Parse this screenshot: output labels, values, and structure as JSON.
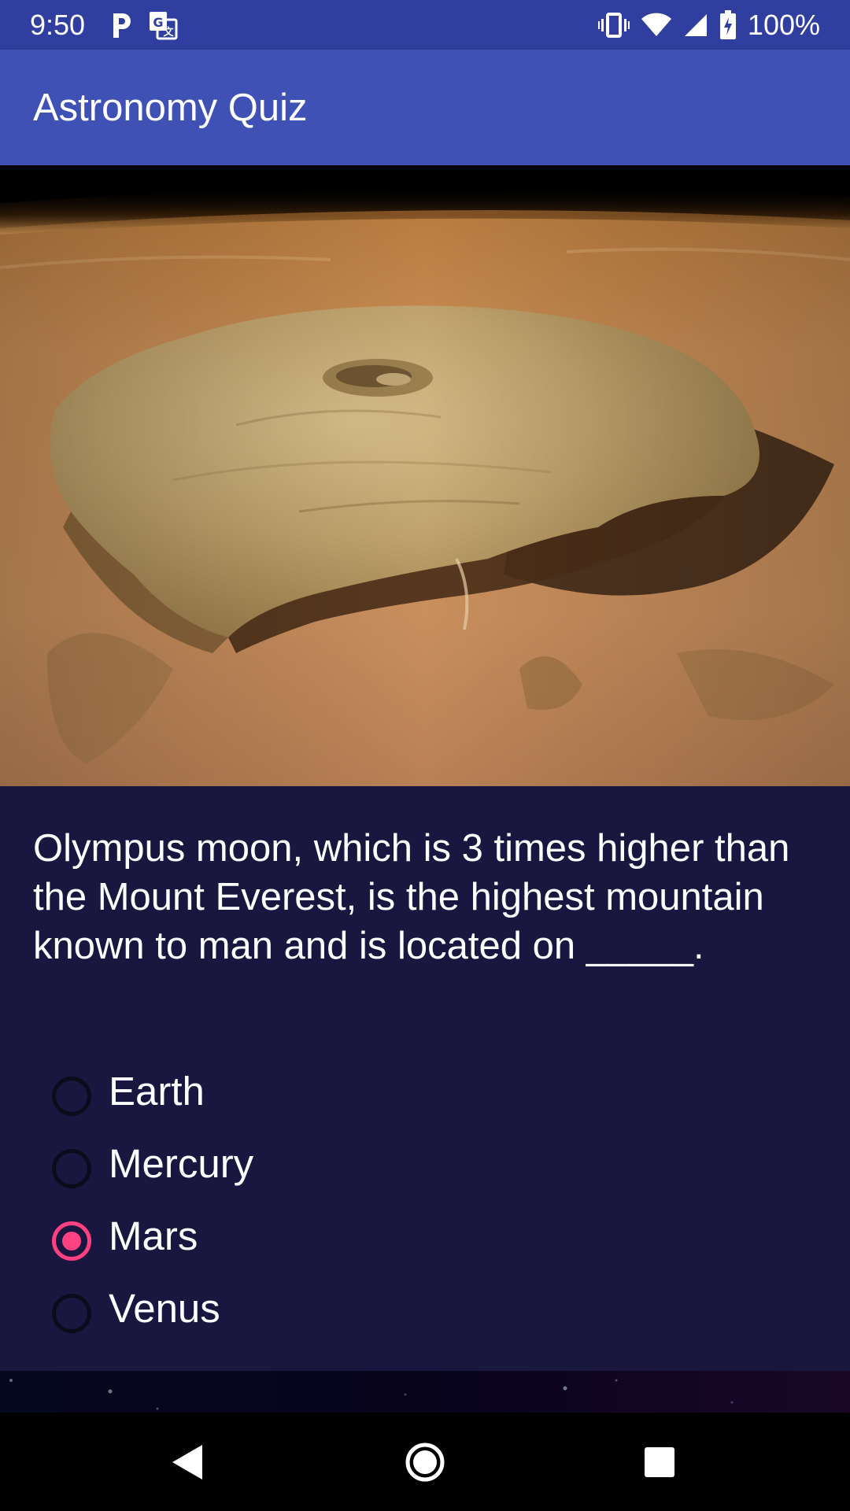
{
  "status_bar": {
    "time": "9:50",
    "battery": "100%",
    "background": "#303f9f",
    "left_icons": [
      "parking-icon",
      "translate-icon"
    ],
    "right_icons": [
      "vibrate-icon",
      "wifi-icon",
      "cell-signal-icon",
      "battery-charging-icon"
    ]
  },
  "app_bar": {
    "title": "Astronomy Quiz",
    "background": "#3f51b5"
  },
  "hero_image": {
    "icon": "olympus-mons-image"
  },
  "quiz": {
    "question": "Olympus moon, which is 3 times higher than the Mount Everest, is the highest mountain known to man and is located on _____.",
    "options": [
      {
        "label": "Earth",
        "selected": false
      },
      {
        "label": "Mercury",
        "selected": false
      },
      {
        "label": "Mars",
        "selected": true
      },
      {
        "label": "Venus",
        "selected": false
      }
    ],
    "accent_color": "#ff4081",
    "background": "#19173f"
  },
  "nav_bar": {
    "buttons": [
      "back-icon",
      "home-icon",
      "recents-icon"
    ]
  }
}
